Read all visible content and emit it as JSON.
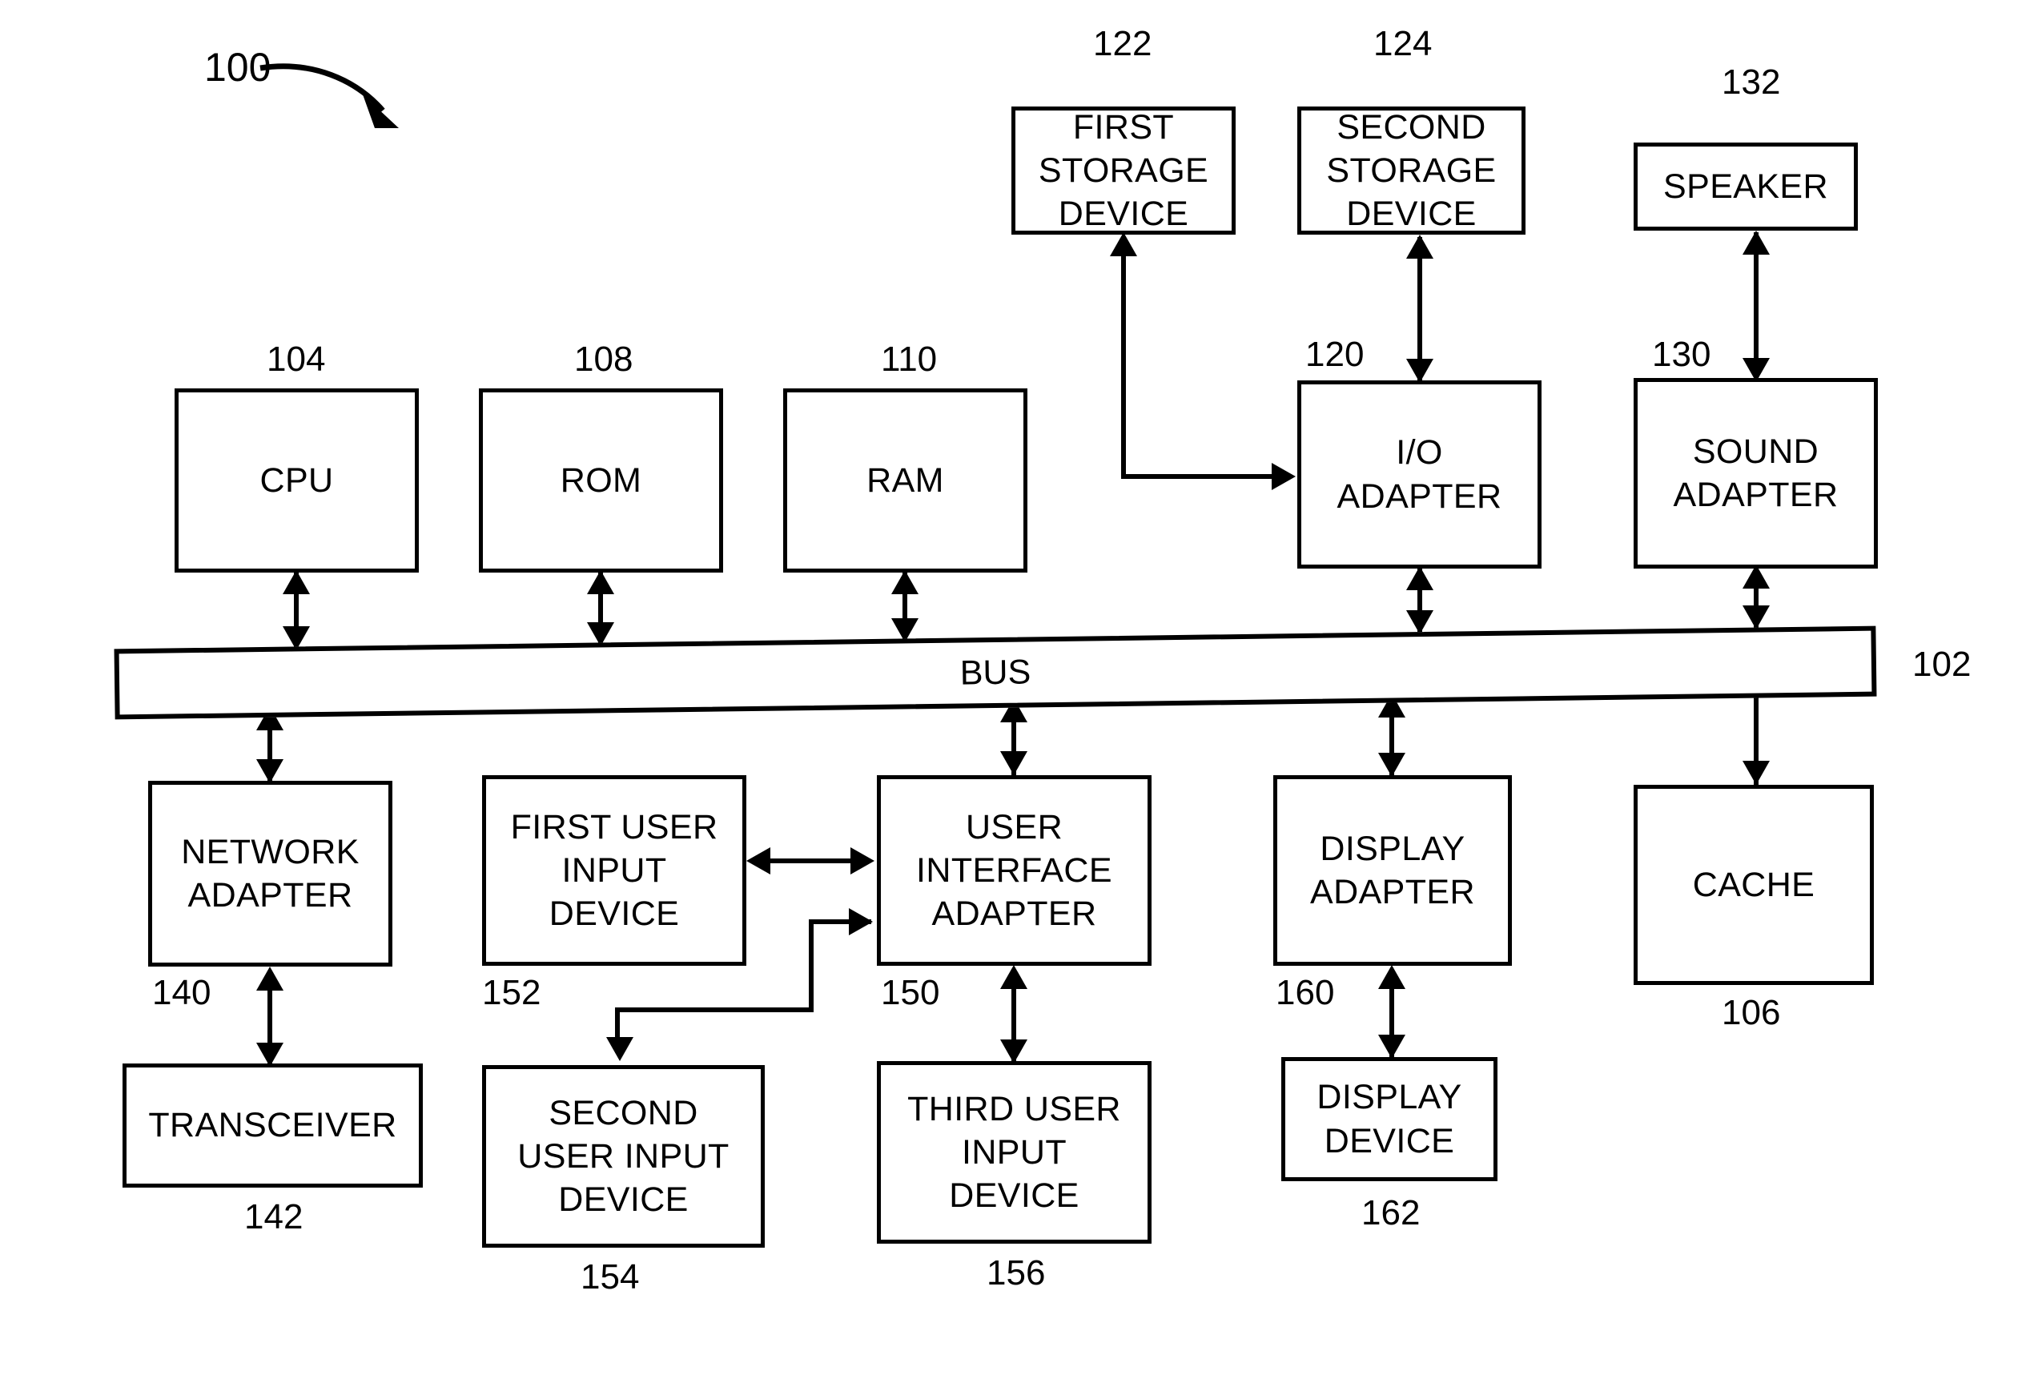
{
  "figure": {
    "number": "100",
    "callout_icon": "curved-arrow-icon"
  },
  "bus": {
    "label": "BUS",
    "ref": "102"
  },
  "blocks": [
    {
      "id": "first-storage-device",
      "lines": [
        "FIRST",
        "STORAGE",
        "DEVICE"
      ],
      "ref": "122"
    },
    {
      "id": "second-storage-device",
      "lines": [
        "SECOND",
        "STORAGE",
        "DEVICE"
      ],
      "ref": "124"
    },
    {
      "id": "speaker",
      "lines": [
        "SPEAKER"
      ],
      "ref": "132"
    },
    {
      "id": "cpu",
      "lines": [
        "CPU"
      ],
      "ref": "104"
    },
    {
      "id": "rom",
      "lines": [
        "ROM"
      ],
      "ref": "108"
    },
    {
      "id": "ram",
      "lines": [
        "RAM"
      ],
      "ref": "110"
    },
    {
      "id": "io-adapter",
      "lines": [
        "I/O",
        "ADAPTER"
      ],
      "ref": "120"
    },
    {
      "id": "sound-adapter",
      "lines": [
        "SOUND",
        "ADAPTER"
      ],
      "ref": "130"
    },
    {
      "id": "network-adapter",
      "lines": [
        "NETWORK",
        "ADAPTER"
      ],
      "ref": "140"
    },
    {
      "id": "first-user-input-device",
      "lines": [
        "FIRST USER",
        "INPUT",
        "DEVICE"
      ],
      "ref": "152"
    },
    {
      "id": "user-interface-adapter",
      "lines": [
        "USER",
        "INTERFACE",
        "ADAPTER"
      ],
      "ref": "150"
    },
    {
      "id": "display-adapter",
      "lines": [
        "DISPLAY",
        "ADAPTER"
      ],
      "ref": "160"
    },
    {
      "id": "cache",
      "lines": [
        "CACHE"
      ],
      "ref": "106"
    },
    {
      "id": "transceiver",
      "lines": [
        "TRANSCEIVER"
      ],
      "ref": "142"
    },
    {
      "id": "second-user-input-device",
      "lines": [
        "SECOND",
        "USER INPUT",
        "DEVICE"
      ],
      "ref": "154"
    },
    {
      "id": "third-user-input-device",
      "lines": [
        "THIRD USER",
        "INPUT",
        "DEVICE"
      ],
      "ref": "156"
    },
    {
      "id": "display-device",
      "lines": [
        "DISPLAY",
        "DEVICE"
      ],
      "ref": "162"
    }
  ],
  "text": {
    "first_storage_l1": "FIRST",
    "first_storage_l2": "STORAGE",
    "first_storage_l3": "DEVICE",
    "first_storage_ref": "122",
    "second_storage_l1": "SECOND",
    "second_storage_l2": "STORAGE",
    "second_storage_l3": "DEVICE",
    "second_storage_ref": "124",
    "speaker_l1": "SPEAKER",
    "speaker_ref": "132",
    "cpu_l1": "CPU",
    "cpu_ref": "104",
    "rom_l1": "ROM",
    "rom_ref": "108",
    "ram_l1": "RAM",
    "ram_ref": "110",
    "io_adapter_l1": "I/O",
    "io_adapter_l2": "ADAPTER",
    "io_adapter_ref": "120",
    "sound_adapter_l1": "SOUND",
    "sound_adapter_l2": "ADAPTER",
    "sound_adapter_ref": "130",
    "bus_label": "BUS",
    "bus_ref": "102",
    "network_adapter_l1": "NETWORK",
    "network_adapter_l2": "ADAPTER",
    "network_adapter_ref": "140",
    "first_uid_l1": "FIRST USER",
    "first_uid_l2": "INPUT",
    "first_uid_l3": "DEVICE",
    "first_uid_ref": "152",
    "uia_l1": "USER",
    "uia_l2": "INTERFACE",
    "uia_l3": "ADAPTER",
    "uia_ref": "150",
    "display_adapter_l1": "DISPLAY",
    "display_adapter_l2": "ADAPTER",
    "display_adapter_ref": "160",
    "cache_l1": "CACHE",
    "cache_ref": "106",
    "transceiver_l1": "TRANSCEIVER",
    "transceiver_ref": "142",
    "second_uid_l1": "SECOND",
    "second_uid_l2": "USER INPUT",
    "second_uid_l3": "DEVICE",
    "second_uid_ref": "154",
    "third_uid_l1": "THIRD USER",
    "third_uid_l2": "INPUT",
    "third_uid_l3": "DEVICE",
    "third_uid_ref": "156",
    "display_device_l1": "DISPLAY",
    "display_device_l2": "DEVICE",
    "display_device_ref": "162",
    "figure_number": "100"
  },
  "colors": {
    "stroke": "#000000",
    "background": "#ffffff"
  }
}
